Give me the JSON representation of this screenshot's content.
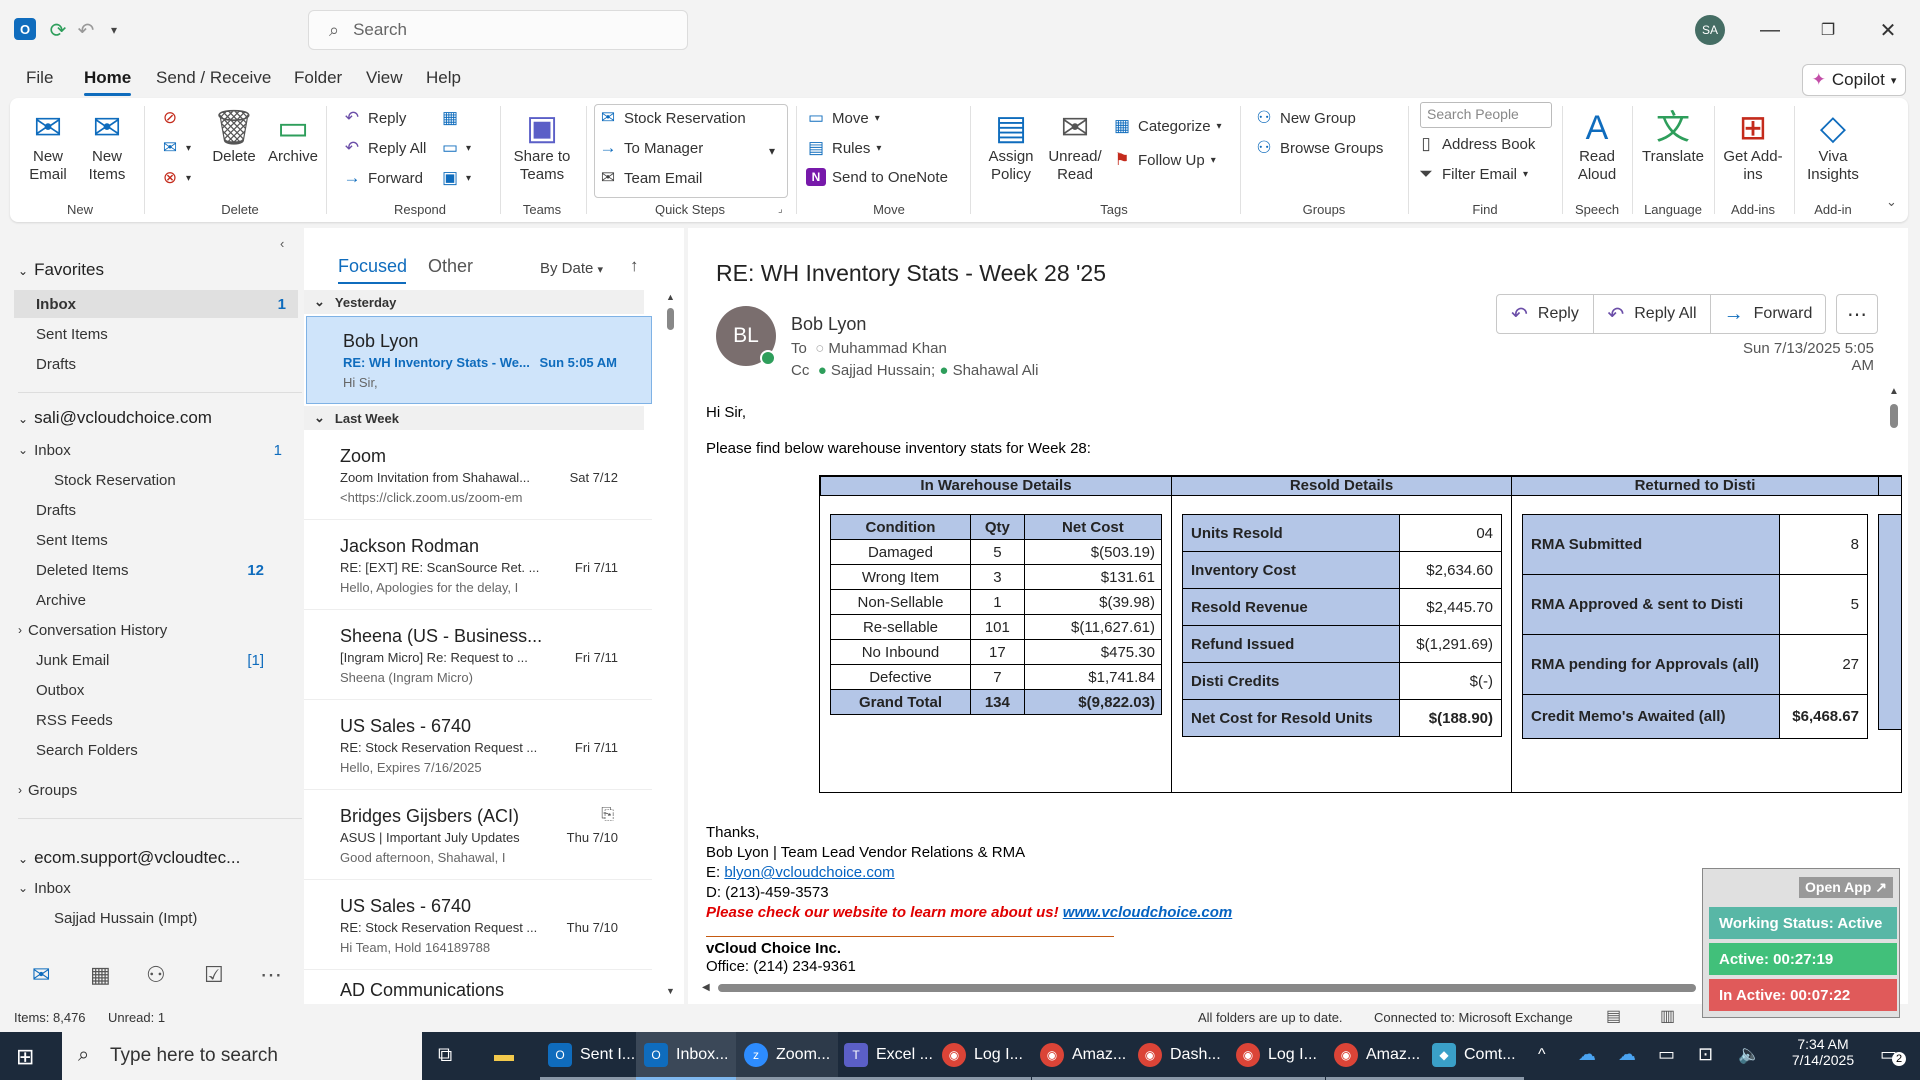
{
  "titlebar": {
    "search_placeholder": "Search",
    "user_initials": "SA"
  },
  "menu": {
    "tabs": [
      "File",
      "Home",
      "Send / Receive",
      "Folder",
      "View",
      "Help"
    ],
    "copilot": "Copilot"
  },
  "ribbon": {
    "new_email": "New Email",
    "new_items": "New Items",
    "delete": "Delete",
    "archive": "Archive",
    "reply": "Reply",
    "reply_all": "Reply All",
    "forward": "Forward",
    "share_teams": "Share to Teams",
    "quick_steps": [
      "Stock Reservation",
      "To Manager",
      "Team Email"
    ],
    "move": "Move",
    "rules": "Rules",
    "onenote": "Send to OneNote",
    "assign_policy": "Assign Policy",
    "unread_read": "Unread/ Read",
    "categorize": "Categorize",
    "follow_up": "Follow Up",
    "new_group": "New Group",
    "browse_groups": "Browse Groups",
    "search_people": "Search People",
    "address_book": "Address Book",
    "filter_email": "Filter Email",
    "read_aloud": "Read Aloud",
    "translate": "Translate",
    "get_addins": "Get Add-ins",
    "viva": "Viva Insights",
    "groups": [
      "New",
      "Delete",
      "Respond",
      "Teams",
      "Quick Steps",
      "Move",
      "Tags",
      "Groups",
      "Find",
      "Speech",
      "Language",
      "Add-ins",
      "Add-in"
    ]
  },
  "folders": {
    "favorites": "Favorites",
    "fav_items": [
      {
        "label": "Inbox",
        "count": "1"
      },
      {
        "label": "Sent Items",
        "count": ""
      },
      {
        "label": "Drafts",
        "count": ""
      }
    ],
    "account1": "sali@vcloudchoice.com",
    "acct1_items": [
      {
        "label": "Inbox",
        "count": "1"
      },
      {
        "label": "Stock Reservation",
        "count": ""
      },
      {
        "label": "Drafts",
        "count": ""
      },
      {
        "label": "Sent Items",
        "count": ""
      },
      {
        "label": "Deleted Items",
        "count": "12"
      },
      {
        "label": "Archive",
        "count": ""
      },
      {
        "label": "Conversation History",
        "count": ""
      },
      {
        "label": "Junk Email",
        "count": "[1]"
      },
      {
        "label": "Outbox",
        "count": ""
      },
      {
        "label": "RSS Feeds",
        "count": ""
      },
      {
        "label": "Search Folders",
        "count": ""
      }
    ],
    "groups": "Groups",
    "account2": "ecom.support@vcloudtec...",
    "acct2_items": [
      {
        "label": "Inbox"
      },
      {
        "label": "Sajjad Hussain (Impt)"
      }
    ]
  },
  "list": {
    "focused": "Focused",
    "other": "Other",
    "sort": "By Date",
    "yesterday": "Yesterday",
    "last_week": "Last Week",
    "messages": [
      {
        "sender": "Bob Lyon",
        "subject": "RE: WH Inventory Stats - We...",
        "date": "Sun 5:05 AM",
        "preview": "Hi Sir,"
      },
      {
        "sender": "Zoom",
        "subject": "Zoom Invitation from Shahawal...",
        "date": "Sat 7/12",
        "preview": "<https://click.zoom.us/zoom-em"
      },
      {
        "sender": "Jackson Rodman",
        "subject": "RE: [EXT] RE: ScanSource Ret. ...",
        "date": "Fri 7/11",
        "preview": "Hello,  Apologies for the delay, I"
      },
      {
        "sender": "Sheena (US - Business...",
        "subject": "[Ingram Micro] Re: Request to ...",
        "date": "Fri 7/11",
        "preview": "Sheena (Ingram Micro)"
      },
      {
        "sender": "US Sales - 6740",
        "subject": "RE: Stock Reservation Request ...",
        "date": "Fri 7/11",
        "preview": "Hello,  Expires 7/16/2025"
      },
      {
        "sender": "Bridges Gijsbers (ACI)",
        "subject": "ASUS | Important July Updates",
        "date": "Thu 7/10",
        "preview": "Good afternoon, Shahawal,   I"
      },
      {
        "sender": "US Sales - 6740",
        "subject": "RE: Stock Reservation Request ...",
        "date": "Thu 7/10",
        "preview": "Hi Team,  Hold 164189788"
      },
      {
        "sender": "AD Communications",
        "subject": "",
        "date": "",
        "preview": ""
      }
    ]
  },
  "email": {
    "subject": "RE: WH Inventory Stats - Week 28 '25",
    "sender_initials": "BL",
    "sender": "Bob Lyon",
    "to_label": "To",
    "to": "Muhammad Khan",
    "cc_label": "Cc",
    "cc1": "Sajjad Hussain;",
    "cc2": "Shahawal Ali",
    "datetime": "Sun 7/13/2025 5:05 AM",
    "reply": "Reply",
    "reply_all": "Reply All",
    "forward": "Forward",
    "greeting": "Hi Sir,",
    "intro": "Please find below warehouse inventory stats for Week 28:",
    "sec1": "In Warehouse Details",
    "sec2": "Resold Details",
    "sec3": "Returned to Disti",
    "wh_headers": [
      "Condition",
      "Qty",
      "Net Cost"
    ],
    "wh_rows": [
      [
        "Damaged",
        "5",
        "$(503.19)"
      ],
      [
        "Wrong Item",
        "3",
        "$131.61"
      ],
      [
        "Non-Sellable",
        "1",
        "$(39.98)"
      ],
      [
        "Re-sellable",
        "101",
        "$(11,627.61)"
      ],
      [
        "No Inbound",
        "17",
        "$475.30"
      ],
      [
        "Defective",
        "7",
        "$1,741.84"
      ]
    ],
    "wh_total": [
      "Grand Total",
      "134",
      "$(9,822.03)"
    ],
    "resold": [
      [
        "Units Resold",
        "04"
      ],
      [
        "Inventory Cost",
        "$2,634.60"
      ],
      [
        "Resold Revenue",
        "$2,445.70"
      ],
      [
        "Refund Issued",
        "$(1,291.69)"
      ],
      [
        "Disti Credits",
        "$(-)"
      ],
      [
        "Net Cost for Resold Units",
        "$(188.90)"
      ]
    ],
    "returned": [
      [
        "RMA Submitted",
        "8"
      ],
      [
        "RMA Approved & sent to Disti",
        "5"
      ],
      [
        "RMA pending for Approvals (all)",
        "27"
      ],
      [
        "Credit Memo's Awaited (all)",
        "$6,468.67"
      ]
    ],
    "thanks": "Thanks,",
    "sig_name": "Bob Lyon | Team Lead Vendor Relations & RMA",
    "sig_e_label": "E: ",
    "sig_email": "blyon@vcloudchoice.com",
    "sig_d": "D: (213)-459-3573",
    "sig_promo": "Please check our website to learn more about us! ",
    "sig_site": "www.vcloudchoice.com",
    "company": "vCloud Choice Inc.",
    "office": "Office: (214) 234-9361"
  },
  "widget": {
    "open_app": "Open App",
    "status": "Working Status: Active",
    "active": "Active: 00:27:19",
    "inactive": "In Active: 00:07:22",
    "colors": {
      "status": "#58b7a6",
      "active": "#41c07a",
      "inactive": "#e05a5a"
    }
  },
  "statusbar": {
    "items": "Items: 8,476",
    "unread": "Unread: 1",
    "sync": "All folders are up to date.",
    "connected": "Connected to: Microsoft Exchange"
  },
  "taskbar": {
    "search": "Type here to search",
    "apps": [
      "Sent I...",
      "Inbox...",
      "Zoom...",
      "Excel ...",
      "Log I...",
      "Amaz...",
      "Dash...",
      "Log I...",
      "Amaz...",
      "Comt..."
    ],
    "time": "7:34 AM",
    "date": "7/14/2025",
    "notif": "2"
  }
}
